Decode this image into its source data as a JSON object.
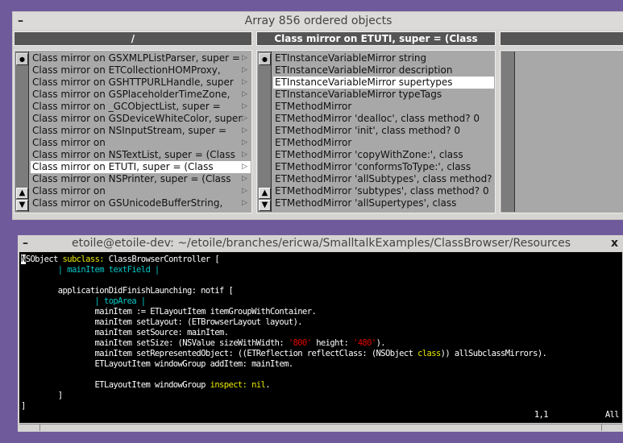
{
  "browser": {
    "title": "Array 856 ordered objects",
    "minimize": "–",
    "columns": [
      {
        "header": "/",
        "selected": 9,
        "items": [
          "Class mirror on GSXMLPListParser, super =",
          "Class mirror on ETCollectionHOMProxy,",
          "Class mirror on GSHTTPURLHandle, super",
          "Class mirror on GSPlaceholderTimeZone,",
          "Class mirror on _GCObjectList, super =",
          "Class mirror on GSDeviceWhiteColor, super",
          "Class mirror on NSInputStream, super =",
          "Class mirror on",
          "Class mirror on NSTextList, super = (Class",
          "Class mirror on ETUTI, super = (Class",
          "Class mirror on NSPrinter, super = (Class",
          "Class mirror on",
          "Class mirror on GSUnicodeBufferString,"
        ]
      },
      {
        "header": "Class mirror on ETUTI, super = (Class",
        "selected": 2,
        "items": [
          "ETInstanceVariableMirror string",
          "ETInstanceVariableMirror description",
          "ETInstanceVariableMirror supertypes",
          "ETInstanceVariableMirror typeTags",
          "ETMethodMirror",
          "ETMethodMirror 'dealloc', class method? 0",
          "ETMethodMirror 'init', class method? 0",
          "ETMethodMirror",
          "ETMethodMirror 'copyWithZone:', class",
          "ETMethodMirror 'conformsToType:', class",
          "ETMethodMirror 'allSubtypes', class method?",
          "ETMethodMirror 'subtypes', class method? 0",
          "ETMethodMirror 'allSupertypes', class"
        ]
      },
      {
        "header": "",
        "selected": -1,
        "items": []
      }
    ]
  },
  "terminal": {
    "title": "etoile@etoile-dev: ~/etoile/branches/ericwa/SmalltalkExamples/ClassBrowser/Resources",
    "minimize": "–",
    "close": "x",
    "colors": {
      "default": "#ffffff",
      "keyword": "#e8e800",
      "ident": "#00c8c8",
      "string": "#e00000"
    },
    "lines": [
      [
        [
          "N",
          "cursor"
        ],
        [
          "SObject ",
          "default"
        ],
        [
          "subclass:",
          "keyword"
        ],
        [
          " ClassBrowserController [",
          "default"
        ]
      ],
      [
        [
          "        ",
          "default"
        ],
        [
          "| mainItem textField |",
          "ident"
        ]
      ],
      [],
      [
        [
          "        applicationDidFinishLaunching: notif [",
          "default"
        ]
      ],
      [
        [
          "                ",
          "default"
        ],
        [
          "| topArea |",
          "ident"
        ]
      ],
      [
        [
          "                mainItem := ETLayoutItem itemGroupWithContainer.",
          "default"
        ]
      ],
      [
        [
          "                mainItem setLayout: (ETBrowserLayout layout).",
          "default"
        ]
      ],
      [
        [
          "                mainItem setSource: mainItem.",
          "default"
        ]
      ],
      [
        [
          "                mainItem setSize: (NSValue sizeWithWidth: ",
          "default"
        ],
        [
          "'800'",
          "string"
        ],
        [
          " height: ",
          "default"
        ],
        [
          "'480'",
          "string"
        ],
        [
          ").",
          "default"
        ]
      ],
      [
        [
          "                mainItem setRepresentedObject: ((ETReflection reflectClass: (NSObject ",
          "default"
        ],
        [
          "class",
          "keyword"
        ],
        [
          ")) allSubclassMirrors).",
          "default"
        ]
      ],
      [
        [
          "                ETLayoutItem windowGroup addItem: mainItem.",
          "default"
        ]
      ],
      [],
      [
        [
          "                ETLayoutItem windowGroup ",
          "default"
        ],
        [
          "inspect:",
          "keyword"
        ],
        [
          " ",
          "default"
        ],
        [
          "nil",
          "keyword"
        ],
        [
          ".",
          "default"
        ]
      ],
      [
        [
          "        ]",
          "default"
        ]
      ],
      [
        [
          "]",
          "default"
        ]
      ]
    ],
    "position": "1,1",
    "scroll": "All"
  }
}
